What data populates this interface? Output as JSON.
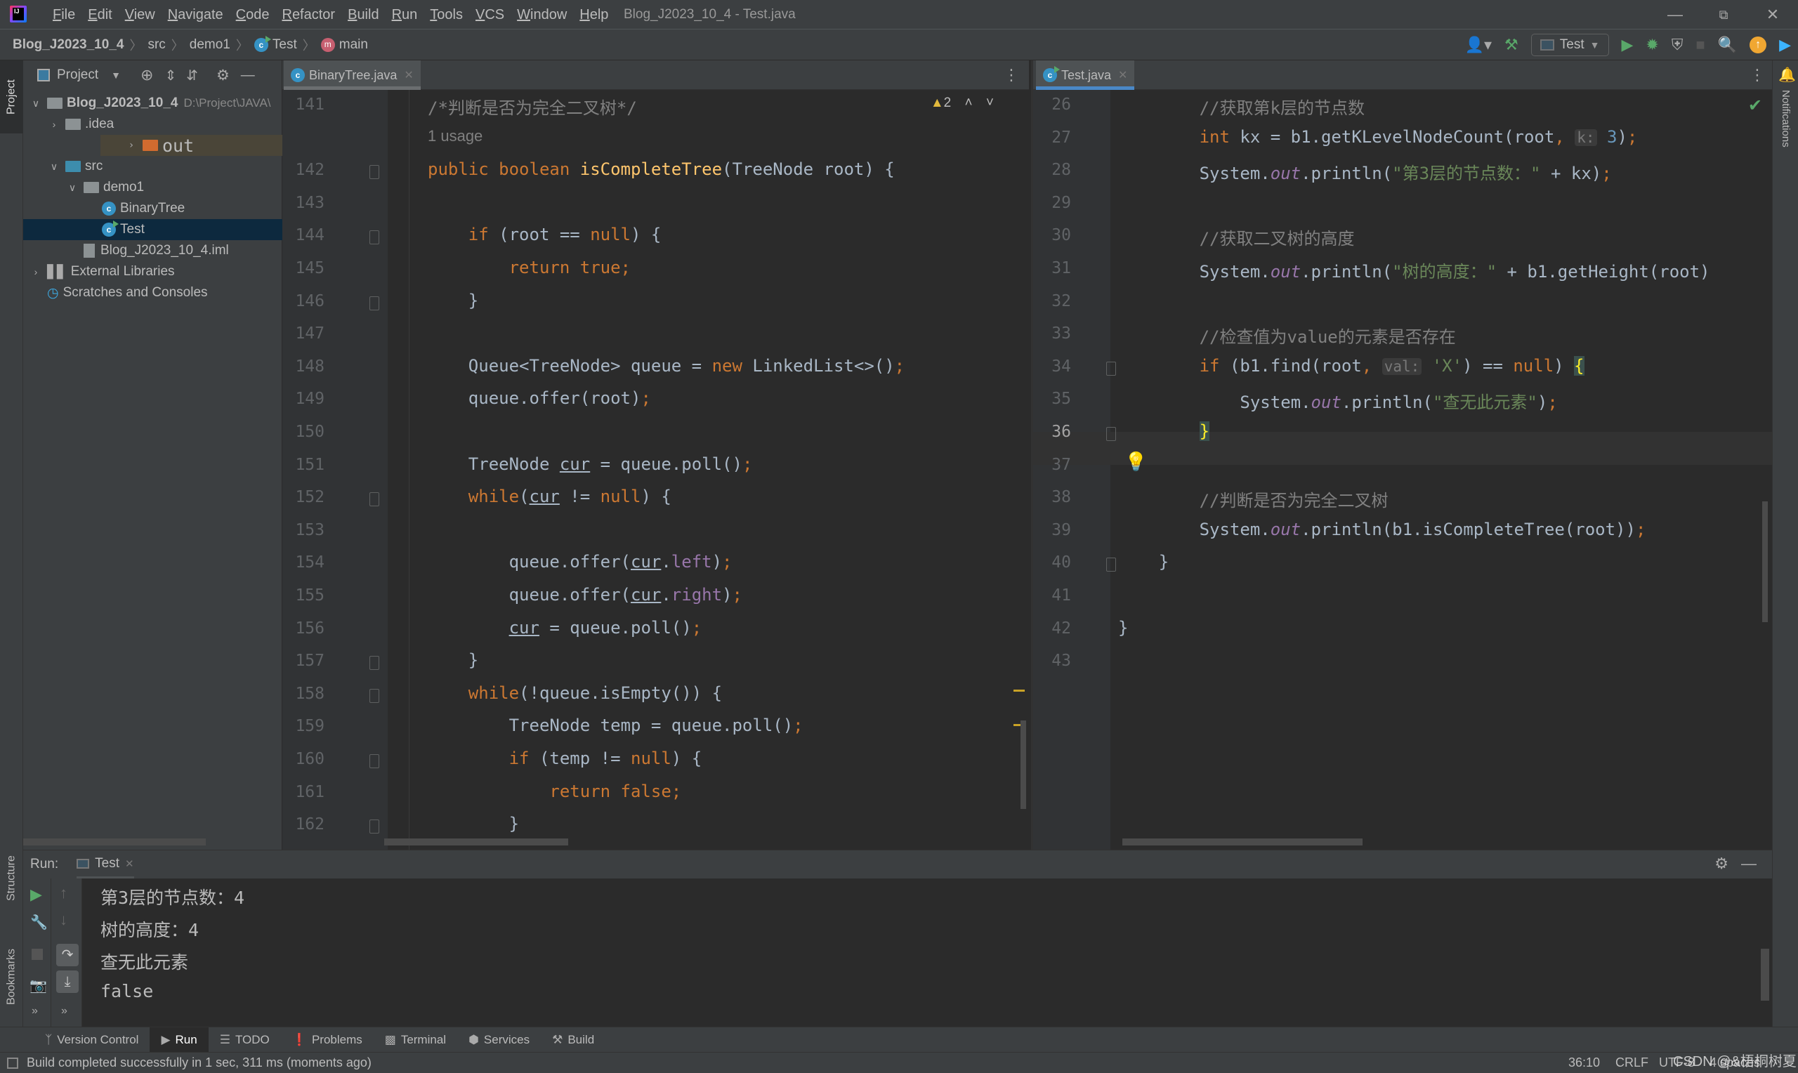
{
  "window": {
    "title": "Blog_J2023_10_4 - Test.java",
    "menu": [
      "File",
      "Edit",
      "View",
      "Navigate",
      "Code",
      "Refactor",
      "Build",
      "Run",
      "Tools",
      "VCS",
      "Window",
      "Help"
    ]
  },
  "breadcrumb": [
    "Blog_J2023_10_4",
    "src",
    "demo1",
    "Test",
    "main"
  ],
  "toolbar": {
    "run_config": "Test"
  },
  "project": {
    "header": "Project",
    "side_tab": "Project",
    "tree": [
      {
        "label": "Blog_J2023_10_4",
        "suffix": "D:\\Project\\JAVA\\",
        "depth": 0,
        "expanded": true,
        "kind": "module"
      },
      {
        "label": ".idea",
        "depth": 1,
        "expanded": false,
        "kind": "folder-gray"
      },
      {
        "label": "out",
        "depth": 1,
        "expanded": false,
        "kind": "folder-orange"
      },
      {
        "label": "src",
        "depth": 1,
        "expanded": true,
        "kind": "folder-blue"
      },
      {
        "label": "demo1",
        "depth": 2,
        "expanded": true,
        "kind": "package"
      },
      {
        "label": "BinaryTree",
        "depth": 3,
        "kind": "class"
      },
      {
        "label": "Test",
        "depth": 3,
        "kind": "class-run",
        "selected": true
      },
      {
        "label": "Blog_J2023_10_4.iml",
        "depth": 2,
        "kind": "iml"
      },
      {
        "label": "External Libraries",
        "depth": 0,
        "expanded": false,
        "kind": "libs"
      },
      {
        "label": "Scratches and Consoles",
        "depth": 0,
        "kind": "scratches"
      }
    ]
  },
  "editor_left": {
    "tab": "BinaryTree.java",
    "warnings": "2",
    "usage_hint": "1 usage",
    "lines": [
      {
        "n": "141",
        "html": "<span class='c'>/*判断是否为完全二叉树*/</span>"
      },
      {
        "n": "142",
        "html": "<span class='k'>public boolean </span><span class='m'>isCompleteTree</span>(TreeNode root) {"
      },
      {
        "n": "143",
        "html": ""
      },
      {
        "n": "144",
        "html": "    <span class='k'>if </span>(root == <span class='k'>null</span>) {"
      },
      {
        "n": "145",
        "html": "        <span class='k'>return true;</span>"
      },
      {
        "n": "146",
        "html": "    }"
      },
      {
        "n": "147",
        "html": ""
      },
      {
        "n": "148",
        "html": "    Queue&lt;TreeNode&gt; queue = <span class='k'>new </span>LinkedList&lt;&gt;()<span class='k'>;</span>"
      },
      {
        "n": "149",
        "html": "    queue.offer(root)<span class='k'>;</span>"
      },
      {
        "n": "150",
        "html": ""
      },
      {
        "n": "151",
        "html": "    TreeNode <span class='u'>cur</span> = queue.poll()<span class='k'>;</span>"
      },
      {
        "n": "152",
        "html": "    <span class='k'>while</span>(<span class='u'>cur</span> != <span class='k'>null</span>) {"
      },
      {
        "n": "153",
        "html": ""
      },
      {
        "n": "154",
        "html": "        queue.offer(<span class='u'>cur</span>.<span class='f'>left</span>)<span class='k'>;</span>"
      },
      {
        "n": "155",
        "html": "        queue.offer(<span class='u'>cur</span>.<span class='f'>right</span>)<span class='k'>;</span>"
      },
      {
        "n": "156",
        "html": "        <span class='u'>cur</span> = queue.poll()<span class='k'>;</span>"
      },
      {
        "n": "157",
        "html": "    }"
      },
      {
        "n": "158",
        "html": "    <span class='k'>while</span>(!queue.isEmpty()) {"
      },
      {
        "n": "159",
        "html": "        TreeNode temp = queue.poll()<span class='k'>;</span>"
      },
      {
        "n": "160",
        "html": "        <span class='k'>if </span>(temp != <span class='k'>null</span>) {"
      },
      {
        "n": "161",
        "html": "            <span class='k'>return false;</span>"
      },
      {
        "n": "162",
        "html": "        }"
      }
    ]
  },
  "editor_right": {
    "tab": "Test.java",
    "lines": [
      {
        "n": "26",
        "html": "        <span class='c'>//获取第k层的节点数</span>"
      },
      {
        "n": "27",
        "html": "        <span class='k'>int </span>kx = b1.getKLevelNodeCount(root<span class='k'>, </span><span class='hint'>k:</span> <span class='n'>3</span>)<span class='k'>;</span>"
      },
      {
        "n": "28",
        "html": "        System.<span class='fi'>out</span>.println(<span class='s'>\"第3层的节点数：\"</span> + kx)<span class='k'>;</span>"
      },
      {
        "n": "29",
        "html": ""
      },
      {
        "n": "30",
        "html": "        <span class='c'>//获取二叉树的高度</span>"
      },
      {
        "n": "31",
        "html": "        System.<span class='fi'>out</span>.println(<span class='s'>\"树的高度：\"</span> + b1.getHeight(root)"
      },
      {
        "n": "32",
        "html": ""
      },
      {
        "n": "33",
        "html": "        <span class='c'>//检查值为value的元素是否存在</span>"
      },
      {
        "n": "34",
        "html": "        <span class='k'>if </span>(b1.find(root<span class='k'>, </span><span class='hint'>val:</span> <span class='s'>'X'</span>) == <span class='k'>null</span>) <span class='brace'>{</span>"
      },
      {
        "n": "35",
        "html": "            System.<span class='fi'>out</span>.println(<span class='s'>\"查无此元素\"</span>)<span class='k'>;</span>"
      },
      {
        "n": "36",
        "html": "        <span class='brace'>}</span>"
      },
      {
        "n": "37",
        "html": ""
      },
      {
        "n": "38",
        "html": "        <span class='c'>//判断是否为完全二叉树</span>"
      },
      {
        "n": "39",
        "html": "        System.<span class='fi'>out</span>.println(b1.isCompleteTree(root))<span class='k'>;</span>"
      },
      {
        "n": "40",
        "html": "    }"
      },
      {
        "n": "41",
        "html": ""
      },
      {
        "n": "42",
        "html": "}"
      },
      {
        "n": "43",
        "html": ""
      }
    ]
  },
  "run": {
    "label": "Run:",
    "tab": "Test",
    "output": [
      "第3层的节点数：4",
      "树的高度：4",
      "查无此元素",
      "false"
    ]
  },
  "side_tabs": {
    "structure": "Structure",
    "bookmarks": "Bookmarks",
    "notifications": "Notifications"
  },
  "bottom_tabs": [
    {
      "label": "Version Control",
      "icon": "branch-icon"
    },
    {
      "label": "Run",
      "icon": "play-icon",
      "active": true
    },
    {
      "label": "TODO",
      "icon": "list-icon"
    },
    {
      "label": "Problems",
      "icon": "problems-icon"
    },
    {
      "label": "Terminal",
      "icon": "terminal-icon"
    },
    {
      "label": "Services",
      "icon": "services-icon"
    },
    {
      "label": "Build",
      "icon": "hammer-icon"
    }
  ],
  "status": {
    "message": "Build completed successfully in 1 sec, 311 ms (moments ago)",
    "position": "36:10",
    "line_sep": "CRLF",
    "encoding": "UTF-8",
    "indent": "4 spaces",
    "watermark": "CSDN @&梧桐树夏"
  },
  "colors": {
    "accent": "#4a88c7",
    "run_green": "#59a869",
    "update_orange": "#f0a732"
  }
}
